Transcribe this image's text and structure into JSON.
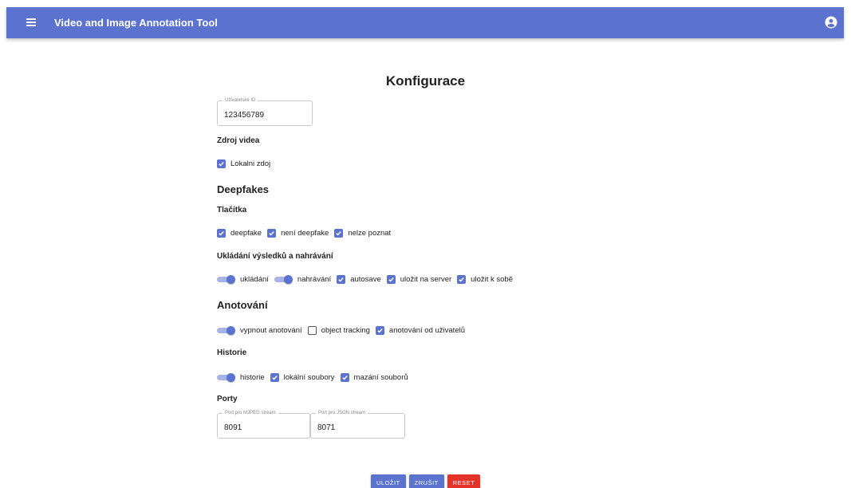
{
  "app": {
    "title": "Video and Image Annotation Tool",
    "menu_icon": "menu-icon",
    "account_icon": "account-circle-icon"
  },
  "colors": {
    "primary": "#5b73cf",
    "danger": "#e53228"
  },
  "page": {
    "title": "Konfigurace"
  },
  "user_id": {
    "label": "Uživatelské ID",
    "value": "123456789"
  },
  "video_source": {
    "title": "Zdroj videa",
    "local_label": "Lokalni zdoj",
    "local_checked": true
  },
  "deepfakes": {
    "title": "Deepfakes",
    "buttons": {
      "title": "Tlačítka",
      "items": [
        {
          "label": "deepfake",
          "checked": true
        },
        {
          "label": "není deepfake",
          "checked": true
        },
        {
          "label": "nelze poznat",
          "checked": true
        }
      ]
    },
    "saving": {
      "title": "Ukládání výsledků a nahrávání",
      "toggles": [
        {
          "label": "ukládání",
          "on": true
        },
        {
          "label": "nahrávání",
          "on": true
        }
      ],
      "checks": [
        {
          "label": "autosave",
          "checked": true
        },
        {
          "label": "uložit na server",
          "checked": true
        },
        {
          "label": "uložit k sobě",
          "checked": true
        }
      ]
    }
  },
  "annotation": {
    "title": "Anotování",
    "toggle": {
      "label": "vypnout anotování",
      "on": true
    },
    "checks": [
      {
        "label": "object tracking",
        "checked": false
      },
      {
        "label": "anotování od uživatelů",
        "checked": true
      }
    ]
  },
  "history": {
    "title": "Historie",
    "toggle": {
      "label": "historie",
      "on": true
    },
    "checks": [
      {
        "label": "lokální soubory",
        "checked": true
      },
      {
        "label": "mazání souborů",
        "checked": true
      }
    ]
  },
  "ports": {
    "title": "Porty",
    "mjpeg": {
      "label": "Port pro MJPEG stream",
      "value": "8091"
    },
    "json": {
      "label": "Port pro JSON stream",
      "value": "8071"
    }
  },
  "actions": {
    "save": "ULOŽIT",
    "cancel": "ZRUŠIT",
    "reset": "RESET"
  }
}
